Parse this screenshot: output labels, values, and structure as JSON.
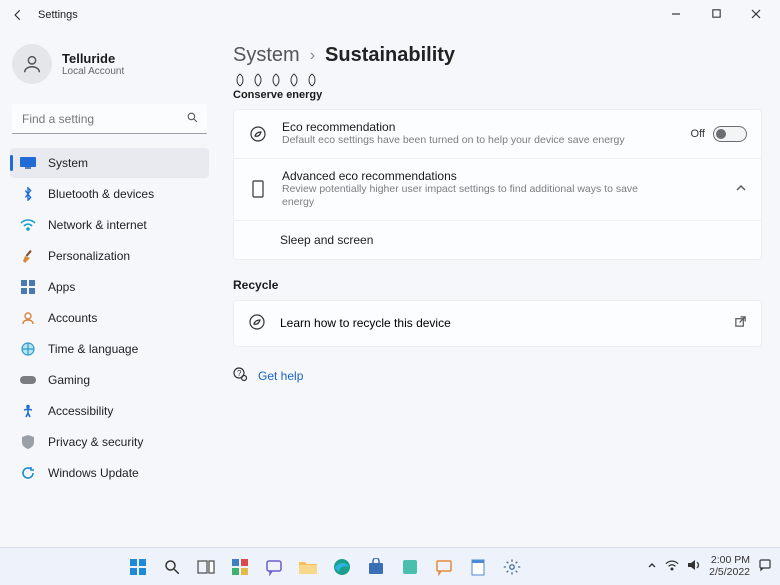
{
  "titlebar": {
    "title": "Settings"
  },
  "user": {
    "name": "Telluride",
    "subtitle": "Local Account"
  },
  "search": {
    "placeholder": "Find a setting"
  },
  "sidebar": {
    "items": [
      {
        "label": "System"
      },
      {
        "label": "Bluetooth & devices"
      },
      {
        "label": "Network & internet"
      },
      {
        "label": "Personalization"
      },
      {
        "label": "Apps"
      },
      {
        "label": "Accounts"
      },
      {
        "label": "Time & language"
      },
      {
        "label": "Gaming"
      },
      {
        "label": "Accessibility"
      },
      {
        "label": "Privacy & security"
      },
      {
        "label": "Windows Update"
      }
    ]
  },
  "breadcrumb": {
    "parent": "System",
    "current": "Sustainability"
  },
  "conserve": {
    "section_label": "Conserve energy",
    "eco_title": "Eco recommendation",
    "eco_desc": "Default eco settings have been turned on to help your device save energy",
    "toggle_state": "Off",
    "adv_title": "Advanced eco recommendations",
    "adv_desc": "Review potentially higher user impact settings to find additional ways to save energy",
    "sub1": "Sleep and screen"
  },
  "recycle": {
    "section_label": "Recycle",
    "link_label": "Learn how to recycle this device"
  },
  "help": {
    "label": "Get help"
  },
  "tray": {
    "time": "2:00 PM",
    "date": "2/5/2022"
  }
}
